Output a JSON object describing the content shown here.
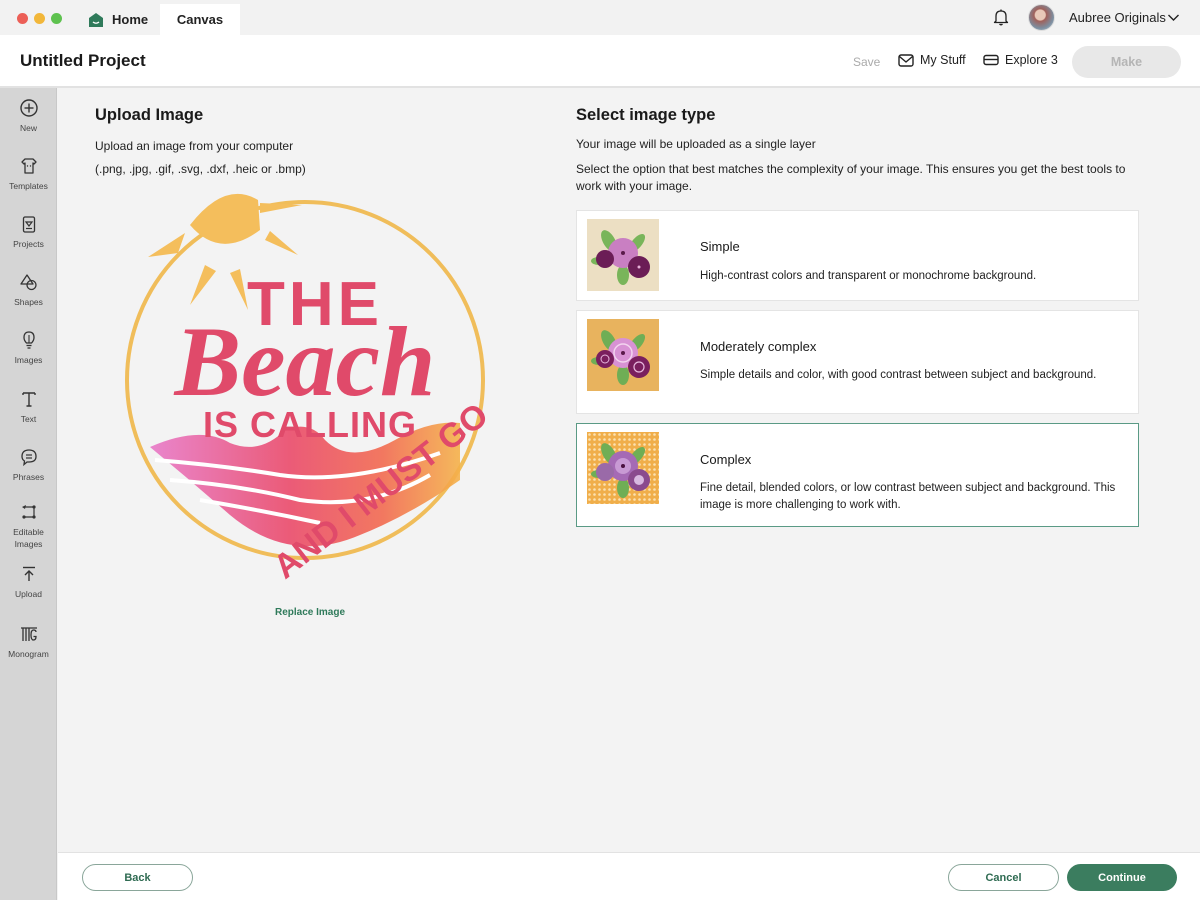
{
  "titlebar": {
    "tabs": [
      {
        "label": "Home",
        "icon": "home-icon"
      },
      {
        "label": "Canvas",
        "active": true
      }
    ],
    "account_name": "Aubree Originals"
  },
  "header": {
    "project_title": "Untitled Project",
    "save_label": "Save",
    "my_stuff_label": "My Stuff",
    "explore_label": "Explore 3",
    "make_label": "Make"
  },
  "sidebar": {
    "items": [
      {
        "label": "New",
        "icon": "plus-circle-icon"
      },
      {
        "label": "Templates",
        "icon": "shirt-icon"
      },
      {
        "label": "Projects",
        "icon": "projects-icon"
      },
      {
        "label": "Shapes",
        "icon": "shapes-icon"
      },
      {
        "label": "Images",
        "icon": "lightbulb-icon"
      },
      {
        "label": "Text",
        "icon": "text-icon"
      },
      {
        "label": "Phrases",
        "icon": "speech-bubble-icon"
      },
      {
        "label": "Editable Images",
        "icon": "editable-images-icon"
      },
      {
        "label": "Upload",
        "icon": "upload-icon"
      },
      {
        "label": "Monogram",
        "icon": "monogram-icon"
      }
    ]
  },
  "upload": {
    "title": "Upload Image",
    "description": "Upload an image from your computer",
    "formats": "(.png, .jpg, .gif, .svg, .dxf, .heic or .bmp)",
    "preview": {
      "line1": "THE",
      "line2": "Beach",
      "line3": "IS CALLING",
      "line4": "AND I MUST GO"
    },
    "replace_label": "Replace Image"
  },
  "image_type": {
    "title": "Select image type",
    "subtitle": "Your image will be uploaded as a single layer",
    "description": "Select the option that best matches the complexity of your image. This ensures you get the best tools to work with your image.",
    "options": [
      {
        "title": "Simple",
        "text": "High-contrast colors and transparent or monochrome background.",
        "selected": false
      },
      {
        "title": "Moderately complex",
        "text": "Simple details and color, with good contrast between subject and background.",
        "selected": false
      },
      {
        "title": "Complex",
        "text": "Fine detail, blended colors, or low contrast between subject and background. This image is more challenging to work with.",
        "selected": true
      }
    ]
  },
  "footer": {
    "back_label": "Back",
    "cancel_label": "Cancel",
    "continue_label": "Continue"
  },
  "colors": {
    "accent": "#3b7d5f",
    "selected_border": "#5a9a85",
    "sidebar_bg": "#d5d5d5"
  }
}
